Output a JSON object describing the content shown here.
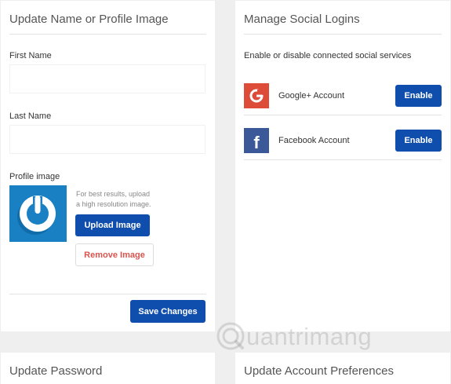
{
  "profile": {
    "title": "Update Name or Profile Image",
    "first_name_label": "First Name",
    "first_name_value": "",
    "last_name_label": "Last Name",
    "last_name_value": "",
    "profile_image_label": "Profile image",
    "avatar_icon": "power-button-icon",
    "hint_line1": "For best results, upload",
    "hint_line2": "a high resolution image.",
    "upload_label": "Upload Image",
    "remove_label": "Remove Image",
    "save_label": "Save Changes"
  },
  "social": {
    "title": "Manage Social Logins",
    "description": "Enable or disable connected social services",
    "accounts": [
      {
        "name": "Google+ Account",
        "icon": "google-icon",
        "icon_glyph": "G",
        "color": "#dd4b39",
        "button": "Enable"
      },
      {
        "name": "Facebook Account",
        "icon": "facebook-icon",
        "icon_glyph": "f",
        "color": "#3b5998",
        "button": "Enable"
      }
    ]
  },
  "password": {
    "title": "Update Password"
  },
  "preferences": {
    "title": "Update Account Preferences"
  },
  "watermark": {
    "text": "uantrimang"
  },
  "colors": {
    "primary_button": "#0f4eac",
    "danger_text": "#d9534f",
    "avatar_bg": "#1a80c4"
  }
}
